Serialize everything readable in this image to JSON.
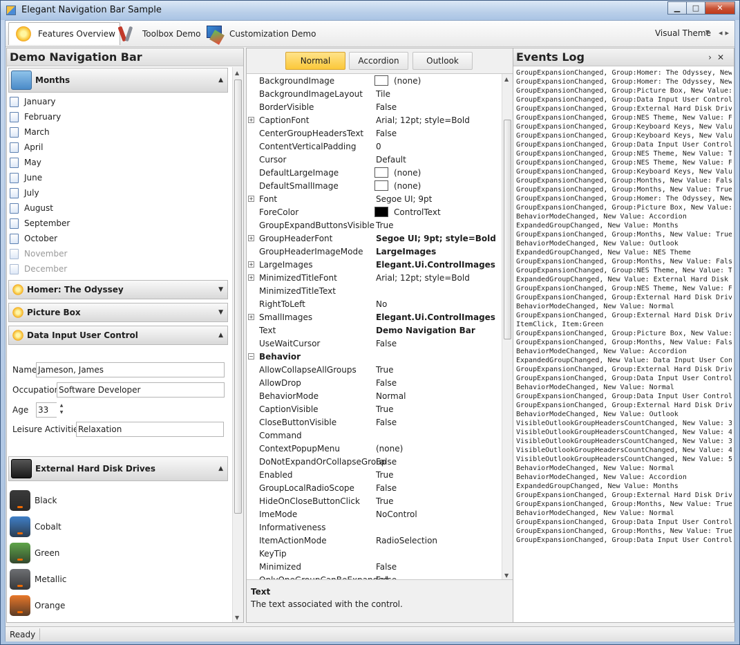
{
  "window": {
    "title": "Elegant Navigation Bar Sample",
    "controls": {
      "minimize": "▁",
      "maximize": "□",
      "close": "✕"
    }
  },
  "topnav": {
    "tabs": [
      {
        "label": "Features Overview",
        "icon": "sun-icon",
        "selected": true
      },
      {
        "label": "Toolbox Demo",
        "icon": "toolbox-icon"
      },
      {
        "label": "Customization Demo",
        "icon": "customization-icon"
      }
    ],
    "theme_label": "Visual Theme",
    "theme_arrow": "▼",
    "nav_arrows": "◂▸"
  },
  "leftnav": {
    "caption": "Demo Navigation Bar",
    "months_group": "Months",
    "months": [
      "January",
      "February",
      "March",
      "April",
      "May",
      "June",
      "July",
      "August",
      "September",
      "October",
      "November",
      "December"
    ],
    "disabled_months": [
      "November",
      "December"
    ],
    "group_homer": "Homer: The Odyssey",
    "group_picture": "Picture Box",
    "group_data_input": "Data Input User Control",
    "form": {
      "name_label": "Name",
      "name_value": "Jameson, James",
      "occupation_label": "Occupation",
      "occupation_value": "Software Developer",
      "age_label": "Age",
      "age_value": "33",
      "leisure_label": "Leisure Activities",
      "leisure_value": "Relaxation"
    },
    "group_drives": "External Hard Disk Drives",
    "drives": [
      {
        "label": "Black",
        "color": "#3a3a3a"
      },
      {
        "label": "Cobalt",
        "color": "#3f7fc7"
      },
      {
        "label": "Green",
        "color": "#5fa54a"
      },
      {
        "label": "Metallic",
        "color": "#6d6f73"
      },
      {
        "label": "Orange",
        "color": "#e8782a"
      }
    ]
  },
  "modes": {
    "normal": "Normal",
    "accordion": "Accordion",
    "outlook": "Outlook",
    "selected": "Normal"
  },
  "props": [
    {
      "name": "BackgroundImage",
      "value": "(none)",
      "swatch": "white"
    },
    {
      "name": "BackgroundImageLayout",
      "value": "Tile"
    },
    {
      "name": "BorderVisible",
      "value": "False"
    },
    {
      "name": "CaptionFont",
      "value": "Arial; 12pt; style=Bold",
      "expand": true
    },
    {
      "name": "CenterGroupHeadersText",
      "value": "False"
    },
    {
      "name": "ContentVerticalPadding",
      "value": "0"
    },
    {
      "name": "Cursor",
      "value": "Default"
    },
    {
      "name": "DefaultLargeImage",
      "value": "(none)",
      "swatch": "white"
    },
    {
      "name": "DefaultSmallImage",
      "value": "(none)",
      "swatch": "white"
    },
    {
      "name": "Font",
      "value": "Segoe UI; 9pt",
      "expand": true
    },
    {
      "name": "ForeColor",
      "value": "ControlText",
      "swatch": "black"
    },
    {
      "name": "GroupExpandButtonsVisible",
      "value": "True"
    },
    {
      "name": "GroupHeaderFont",
      "value": "Segoe UI; 9pt; style=Bold",
      "expand": true,
      "bold": true
    },
    {
      "name": "GroupHeaderImageMode",
      "value": "LargeImages",
      "bold": true
    },
    {
      "name": "LargeImages",
      "value": "Elegant.Ui.ControlImages",
      "expand": true,
      "bold": true
    },
    {
      "name": "MinimizedTitleFont",
      "value": "Arial; 12pt; style=Bold",
      "expand": true
    },
    {
      "name": "MinimizedTitleText",
      "value": ""
    },
    {
      "name": "RightToLeft",
      "value": "No"
    },
    {
      "name": "SmallImages",
      "value": "Elegant.Ui.ControlImages",
      "expand": true,
      "bold": true
    },
    {
      "name": "Text",
      "value": "Demo Navigation Bar",
      "bold": true
    },
    {
      "name": "UseWaitCursor",
      "value": "False"
    },
    {
      "name": "Behavior",
      "category": true
    },
    {
      "name": "AllowCollapseAllGroups",
      "value": "True"
    },
    {
      "name": "AllowDrop",
      "value": "False"
    },
    {
      "name": "BehaviorMode",
      "value": "Normal"
    },
    {
      "name": "CaptionVisible",
      "value": "True"
    },
    {
      "name": "CloseButtonVisible",
      "value": "False"
    },
    {
      "name": "Command",
      "value": ""
    },
    {
      "name": "ContextPopupMenu",
      "value": "(none)"
    },
    {
      "name": "DoNotExpandOrCollapseGroup",
      "value": "False"
    },
    {
      "name": "Enabled",
      "value": "True"
    },
    {
      "name": "GroupLocalRadioScope",
      "value": "False"
    },
    {
      "name": "HideOnCloseButtonClick",
      "value": "True"
    },
    {
      "name": "ImeMode",
      "value": "NoControl"
    },
    {
      "name": "Informativeness",
      "value": ""
    },
    {
      "name": "ItemActionMode",
      "value": "RadioSelection"
    },
    {
      "name": "KeyTip",
      "value": ""
    },
    {
      "name": "Minimized",
      "value": "False"
    },
    {
      "name": "OnlyOneGroupCanBeExpanded",
      "value": "False"
    }
  ],
  "description": {
    "title": "Text",
    "text": "The text associated with the control."
  },
  "events": {
    "caption": "Events Log",
    "pin": "›",
    "close": "✕",
    "lines": [
      "GroupExpansionChanged, Group:Homer: The Odyssey, New",
      "GroupExpansionChanged, Group:Homer: The Odyssey, New",
      "GroupExpansionChanged, Group:Picture Box, New Value:",
      "GroupExpansionChanged, Group:Data Input User Control",
      "GroupExpansionChanged, Group:External Hard Disk Driv",
      "GroupExpansionChanged, Group:NES Theme, New Value: F",
      "GroupExpansionChanged, Group:Keyboard Keys, New Valu",
      "GroupExpansionChanged, Group:Keyboard Keys, New Valu",
      "GroupExpansionChanged, Group:Data Input User Control",
      "GroupExpansionChanged, Group:NES Theme, New Value: T",
      "GroupExpansionChanged, Group:NES Theme, New Value: F",
      "GroupExpansionChanged, Group:Keyboard Keys, New Valu",
      "GroupExpansionChanged, Group:Months, New Value: Fals",
      "GroupExpansionChanged, Group:Months, New Value: True",
      "GroupExpansionChanged, Group:Homer: The Odyssey, New",
      "GroupExpansionChanged, Group:Picture Box, New Value:",
      "BehaviorModeChanged, New Value: Accordion",
      "ExpandedGroupChanged, New Value: Months",
      "GroupExpansionChanged, Group:Months, New Value: True",
      "BehaviorModeChanged, New Value: Outlook",
      "ExpandedGroupChanged, New Value: NES Theme",
      "GroupExpansionChanged, Group:Months, New Value: Fals",
      "GroupExpansionChanged, Group:NES Theme, New Value: T",
      "ExpandedGroupChanged, New Value: External Hard Disk",
      "GroupExpansionChanged, Group:NES Theme, New Value: F",
      "GroupExpansionChanged, Group:External Hard Disk Driv",
      "BehaviorModeChanged, New Value: Normal",
      "GroupExpansionChanged, Group:External Hard Disk Driv",
      "ItemClick, Item:Green",
      "GroupExpansionChanged, Group:Picture Box, New Value:",
      "GroupExpansionChanged, Group:Months, New Value: Fals",
      "BehaviorModeChanged, New Value: Accordion",
      "ExpandedGroupChanged, New Value: Data Input User Con",
      "GroupExpansionChanged, Group:External Hard Disk Driv",
      "GroupExpansionChanged, Group:Data Input User Control",
      "BehaviorModeChanged, New Value: Normal",
      "GroupExpansionChanged, Group:Data Input User Control",
      "GroupExpansionChanged, Group:External Hard Disk Driv",
      "BehaviorModeChanged, New Value: Outlook",
      "VisibleOutlookGroupHeadersCountChanged, New Value: 3",
      "VisibleOutlookGroupHeadersCountChanged, New Value: 4",
      "VisibleOutlookGroupHeadersCountChanged, New Value: 3",
      "VisibleOutlookGroupHeadersCountChanged, New Value: 4",
      "VisibleOutlookGroupHeadersCountChanged, New Value: 5",
      "BehaviorModeChanged, New Value: Normal",
      "BehaviorModeChanged, New Value: Accordion",
      "ExpandedGroupChanged, New Value: Months",
      "GroupExpansionChanged, Group:External Hard Disk Driv",
      "GroupExpansionChanged, Group:Months, New Value: True",
      "BehaviorModeChanged, New Value: Normal",
      "GroupExpansionChanged, Group:Data Input User Control",
      "GroupExpansionChanged, Group:Months, New Value: True",
      "GroupExpansionChanged, Group:Data Input User Control"
    ]
  },
  "status": {
    "text": "Ready"
  }
}
